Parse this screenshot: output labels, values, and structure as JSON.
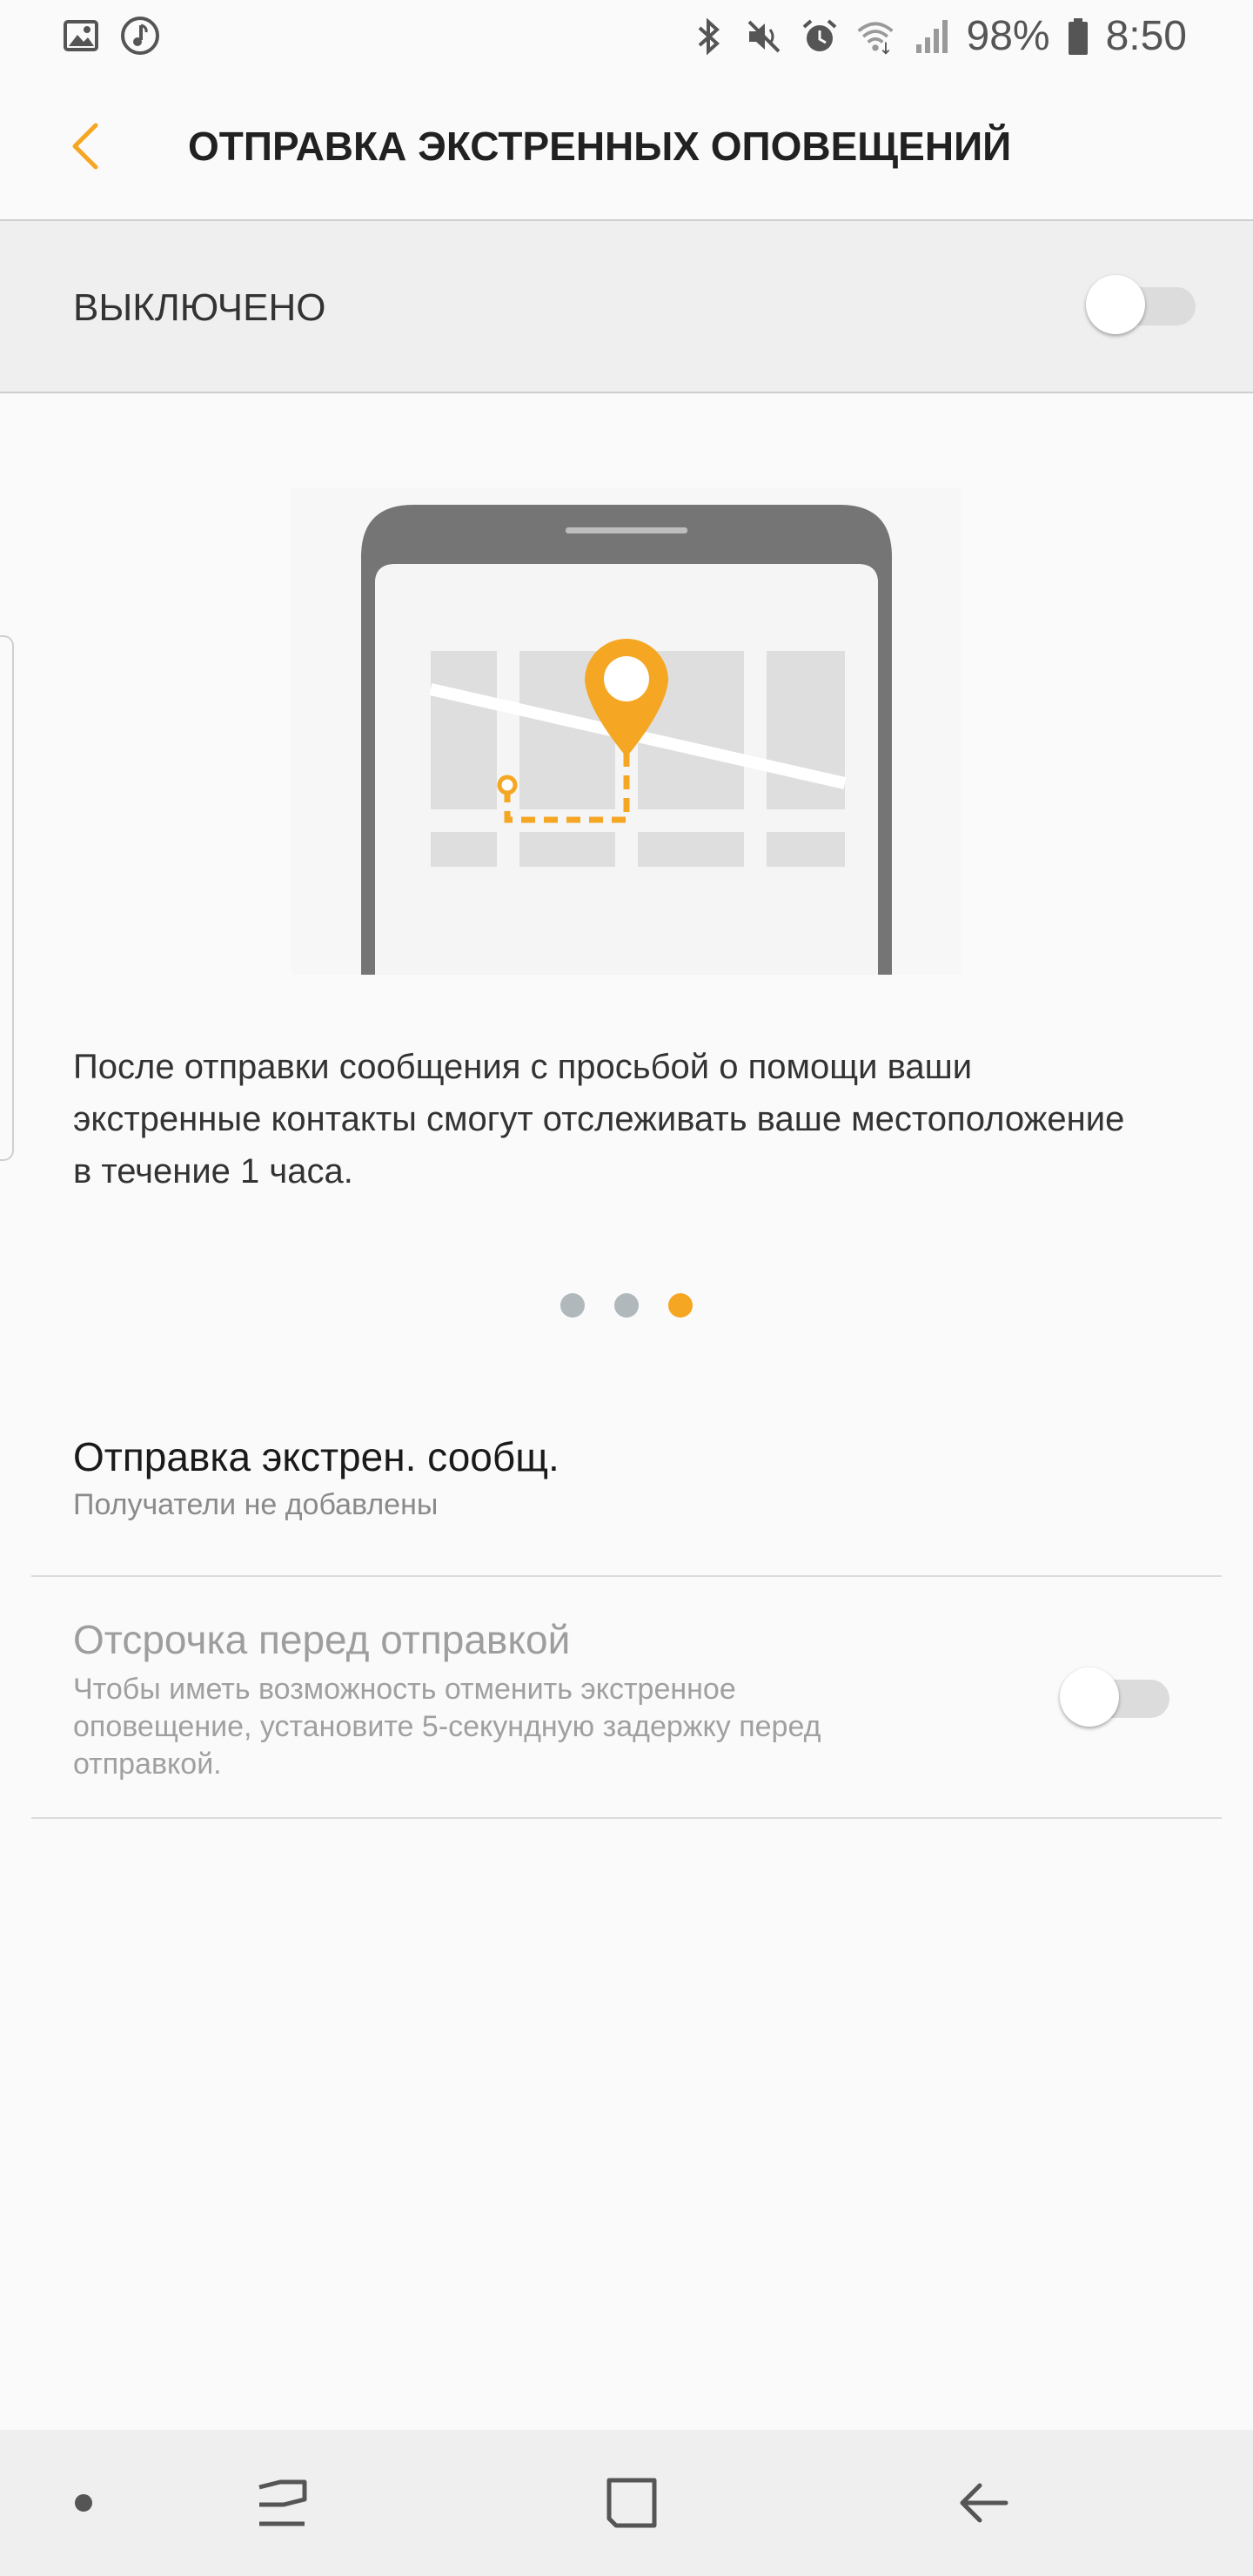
{
  "status_bar": {
    "battery_text": "98%",
    "time": "8:50",
    "icons_left": [
      "gallery-icon",
      "music-icon"
    ],
    "icons_right": [
      "bluetooth-icon",
      "mute-icon",
      "alarm-icon",
      "wifi-icon",
      "signal-icon",
      "battery-icon"
    ]
  },
  "header": {
    "title": "ОТПРАВКА ЭКСТРЕННЫХ ОПОВЕЩЕНИЙ",
    "back_icon": "chevron-left-icon"
  },
  "master_switch": {
    "label": "ВЫКЛЮЧЕНО",
    "state": "off"
  },
  "illustration": {
    "icon": "phone-map-pin-illustration"
  },
  "description": "После отправки сообщения с просьбой о помощи ваши экстренные контакты смогут отслеживать ваше местоположение в течение 1 часа.",
  "pager": {
    "count": 3,
    "active_index": 2
  },
  "settings": {
    "send_message": {
      "title": "Отправка экстрен. сообщ.",
      "subtitle": "Получатели не добавлены"
    },
    "delay": {
      "title": "Отсрочка перед отправкой",
      "subtitle": "Чтобы иметь возможность отменить экстренное оповещение, установите 5-секундную задержку перед отправкой.",
      "state": "off"
    }
  },
  "nav_bar": {
    "buttons": [
      "dot-icon",
      "recents-icon",
      "home-icon",
      "back-icon"
    ]
  },
  "colors": {
    "accent": "#f5a623",
    "background": "#fafafa",
    "bar_background": "#efefef"
  }
}
